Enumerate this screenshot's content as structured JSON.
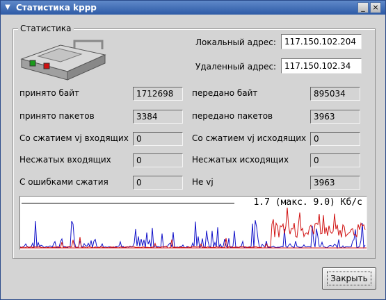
{
  "window": {
    "title": "Статистика kppp"
  },
  "group": {
    "title": "Статистика"
  },
  "address": {
    "local_label": "Локальный адрес:",
    "local_value": "117.150.102.204",
    "remote_label": "Удаленный адрес:",
    "remote_value": "117.150.102.34"
  },
  "stats": {
    "left": [
      {
        "label": "принято байт",
        "value": "1712698"
      },
      {
        "label": "принято пакетов",
        "value": "3384"
      },
      {
        "label": "Со сжатием vj входящих",
        "value": "0"
      },
      {
        "label": "Несжатых входящих",
        "value": "0"
      },
      {
        "label": "С ошибками сжатия",
        "value": "0"
      }
    ],
    "right": [
      {
        "label": "передано байт",
        "value": "895034"
      },
      {
        "label": "передано пакетов",
        "value": "3963"
      },
      {
        "label": "Со сжатием vj исходящих",
        "value": "0"
      },
      {
        "label": "Несжатых исходящих",
        "value": "0"
      },
      {
        "label": "Не vj",
        "value": "3963"
      }
    ]
  },
  "graph": {
    "text": "1.7 (макс. 9.0) Кб/с",
    "colors": {
      "in": "#1010c8",
      "out": "#d01010"
    }
  },
  "buttons": {
    "close": "Закрыть"
  }
}
